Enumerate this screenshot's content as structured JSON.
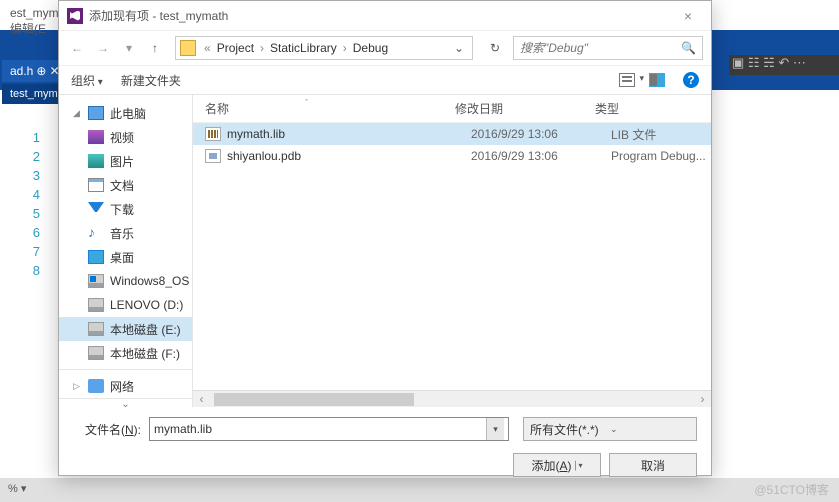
{
  "editor": {
    "menu_edit": "编辑(E",
    "tab1": "ad.h",
    "tab1_suffix": "✕",
    "tab1_pin": "⊕",
    "tab2": "test_mym",
    "tab2_prefix": "est_myma",
    "lines": [
      "1",
      "2",
      "3",
      "4",
      "5",
      "6",
      "7",
      "8"
    ],
    "status": "%  ▾",
    "righticons": "▣ ☷ ☵ ↶ ⋯"
  },
  "dialog": {
    "title": "添加现有项 - test_mymath",
    "nav": {
      "back": "←",
      "fwd": "→",
      "hist": "▾",
      "up": "↑"
    },
    "crumbs": {
      "pre": "«",
      "seg1": "Project",
      "seg2": "StaticLibrary",
      "seg3": "Debug",
      "sep": "›",
      "drop": "⌄",
      "refresh": "↻"
    },
    "search": {
      "placeholder": "搜索\"Debug\""
    },
    "toolrow": {
      "org": "组织",
      "newf": "新建文件夹",
      "help": "?"
    },
    "columns": {
      "name": "名称",
      "date": "修改日期",
      "type": "类型",
      "sort": "ˆ"
    },
    "side": [
      {
        "ic": "pc",
        "label": "此电脑",
        "tri": "◢"
      },
      {
        "ic": "vid",
        "label": "视频"
      },
      {
        "ic": "pic",
        "label": "图片"
      },
      {
        "ic": "doc",
        "label": "文档"
      },
      {
        "ic": "dl",
        "label": "下载"
      },
      {
        "ic": "mus",
        "label": "音乐",
        "glyph": "♪"
      },
      {
        "ic": "desk",
        "label": "桌面"
      },
      {
        "ic": "drv win",
        "label": "Windows8_OS"
      },
      {
        "ic": "drv",
        "label": "LENOVO (D:)"
      },
      {
        "ic": "drv",
        "label": "本地磁盘 (E:)",
        "sel": true
      },
      {
        "ic": "drv",
        "label": "本地磁盘 (F:)"
      }
    ],
    "side_net": "网络",
    "files": [
      {
        "ic": "lib",
        "name": "mymath.lib",
        "date": "2016/9/29 13:06",
        "type": "LIB 文件",
        "sel": true
      },
      {
        "ic": "pdb",
        "name": "shiyanlou.pdb",
        "date": "2016/9/29 13:06",
        "type": "Program Debug..."
      }
    ],
    "fn": {
      "label_pre": "文件名(",
      "label_u": "N",
      "label_post": "):",
      "value": "mymath.lib",
      "filter": "所有文件(*.*)"
    },
    "btns": {
      "add_pre": "添加(",
      "add_u": "A",
      "add_post": ")",
      "cancel": "取消"
    }
  },
  "watermark": "@51CTO博客"
}
